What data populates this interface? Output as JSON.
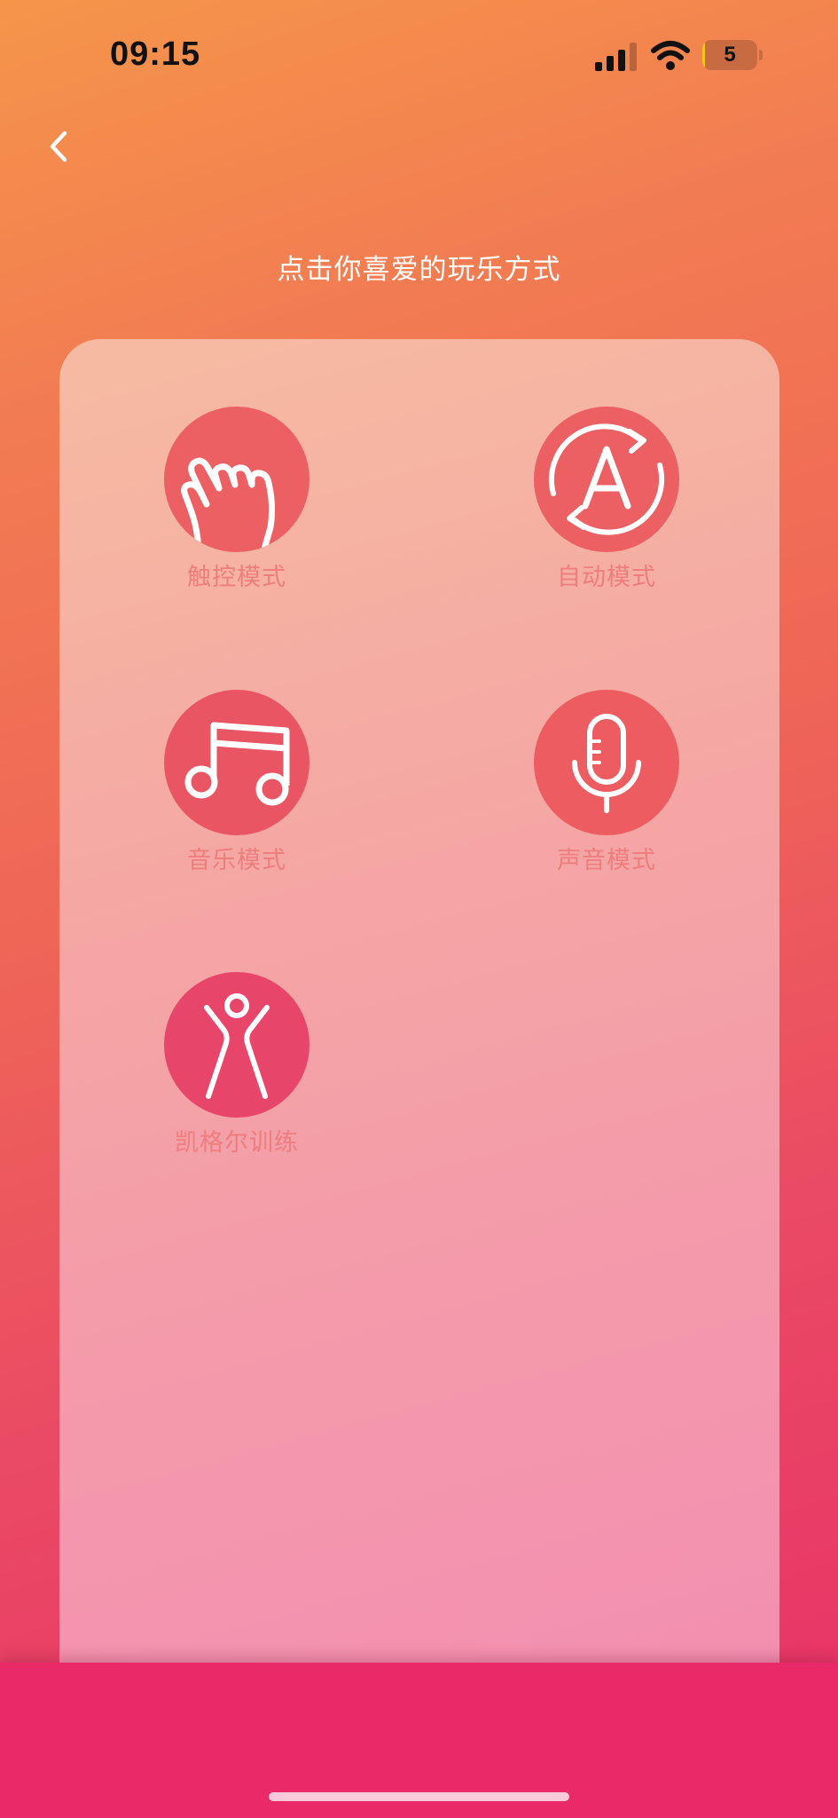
{
  "status_bar": {
    "time": "09:15",
    "battery_level": "5",
    "battery_fraction": 0.05,
    "icons": [
      "signal-icon",
      "wifi-icon",
      "battery-icon"
    ]
  },
  "nav": {
    "back_icon": "chevron-left-icon"
  },
  "page": {
    "title": "点击你喜爱的玩乐方式"
  },
  "modes": [
    {
      "label": "触控模式",
      "icon": "hand-touch-icon",
      "color": "#ec5f62"
    },
    {
      "label": "自动模式",
      "icon": "auto-mode-icon",
      "color": "#ec5f62"
    },
    {
      "label": "音乐模式",
      "icon": "music-note-icon",
      "color": "#ea5564"
    },
    {
      "label": "声音模式",
      "icon": "microphone-icon",
      "color": "#ec5c60"
    },
    {
      "label": "凯格尔训练",
      "icon": "kegel-exercise-icon",
      "color": "#e8456a"
    }
  ],
  "colors": {
    "background_top": "#f5954a",
    "background_bottom": "#e83068",
    "card": "#f5a8a3",
    "label": "#ee7d7e",
    "bottom_bar": "#ea2a68"
  }
}
